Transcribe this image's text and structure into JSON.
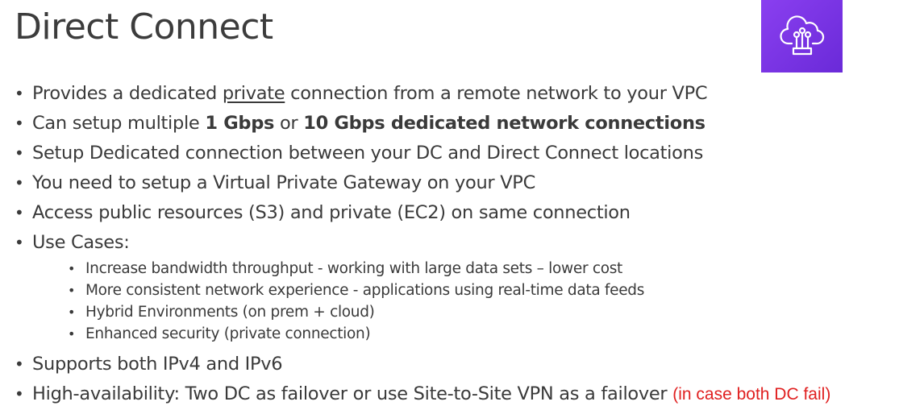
{
  "title": "Direct Connect",
  "logo": {
    "icon": "cloud-circuit-icon",
    "color": "#7b36e8"
  },
  "bullets": {
    "b1": {
      "pre": "Provides a dedicated ",
      "underline": "private",
      "post": " connection from a remote network to your VPC"
    },
    "b2": {
      "pre": "Can setup multiple ",
      "bold": "1 Gbps",
      "mid": " or ",
      "bold2": "10 Gbps dedicated network connections"
    },
    "b3": "Setup Dedicated connection between your DC and Direct Connect locations",
    "b4": "You need to setup a Virtual Private Gateway on your VPC",
    "b5": "Access public resources (S3) and private (EC2) on same connection",
    "b6": "Use Cases:",
    "use_cases": [
      "Increase bandwidth throughput - working with large data sets – lower cost",
      "More consistent network experience - applications using real-time data feeds",
      "Hybrid Environments (on prem + cloud)",
      "Enhanced security (private connection)"
    ],
    "b7": "Supports both IPv4 and IPv6",
    "b8": {
      "main": "High-availability: Two DC as failover or use Site-to-Site VPN as a failover ",
      "note": "(in case both DC fail)"
    }
  }
}
